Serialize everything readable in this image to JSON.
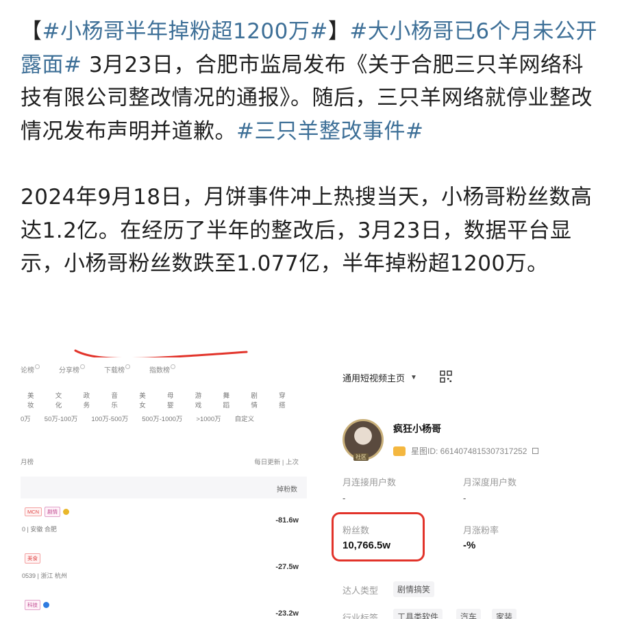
{
  "post": {
    "paragraph1": [
      {
        "text": "【",
        "tag": false
      },
      {
        "text": "#小杨哥半年掉粉超1200万#",
        "tag": true
      },
      {
        "text": "】",
        "tag": false
      },
      {
        "text": "#大小杨哥已6个月未公开露面#",
        "tag": true
      },
      {
        "text": " 3月23日，合肥市监局发布《关于合肥三只羊网络科技有限公司整改情况的通报》。随后，三只羊网络就停业整改情况发布声明并道歉。",
        "tag": false
      },
      {
        "text": "#三只羊整改事件#",
        "tag": true
      }
    ],
    "paragraph2": "2024年9月18日，月饼事件冲上热搜当天，小杨哥粉丝数高达1.2亿。在经历了半年的整改后，3月23日，数据平台显示，小杨哥粉丝数跌至1.077亿，半年掉粉超1200万。"
  },
  "colors": {
    "hashtag": "#3d6f97",
    "underline": "#e2332a",
    "highlight": "#e2332a"
  },
  "left_shot": {
    "tabs": [
      "论榜",
      "分享榜",
      "下载榜",
      "指数榜"
    ],
    "categories": [
      "美妆",
      "文化",
      "政务",
      "音乐",
      "美女",
      "母婴",
      "游戏",
      "舞蹈",
      "剧情",
      "穿搭"
    ],
    "ranges": [
      "0万",
      "50万-100万",
      "100万-500万",
      "500万-1000万",
      ">1000万",
      "自定义"
    ],
    "list_title": "月榜",
    "update_note": "每日更新 | 上次",
    "column": "掉粉数",
    "rows": [
      {
        "badges": [
          "MCN",
          "剧情"
        ],
        "badge_style": [
          "red",
          "purple"
        ],
        "verify": "gold",
        "location": "0 | 安徽 合肥",
        "value": "-81.6w"
      },
      {
        "badges": [
          "美食"
        ],
        "badge_style": [
          "red"
        ],
        "verify": "",
        "location": "0539 | 浙江 杭州",
        "value": "-27.5w"
      },
      {
        "badges": [
          "科技"
        ],
        "badge_style": [
          "purple"
        ],
        "verify": "blue",
        "location": "",
        "value": "-23.2w"
      }
    ]
  },
  "right_shot": {
    "header": "通用短视频主页",
    "avatar_tag": "社区",
    "name": "疯狂小杨哥",
    "id_label": "星图ID: 6614074815307317252",
    "stats": [
      {
        "label": "月连接用户数",
        "value": "-"
      },
      {
        "label": "月深度用户数",
        "value": "-"
      },
      {
        "label": "粉丝数",
        "value": "10,766.5w"
      },
      {
        "label": "月涨粉率",
        "value": "-%"
      }
    ],
    "talent_type_label": "达人类型",
    "talent_type_value": "剧情搞笑",
    "industry_label": "行业标签",
    "industry_tags": [
      "工具类软件",
      "汽车",
      "家装"
    ]
  }
}
